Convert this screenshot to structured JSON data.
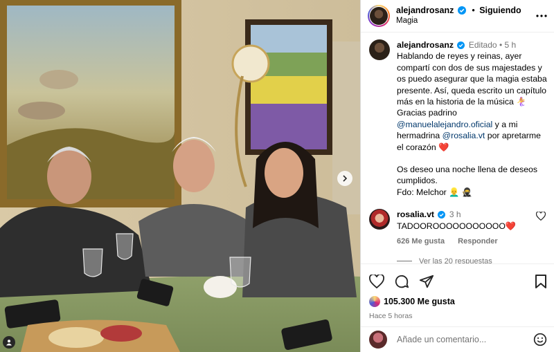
{
  "header": {
    "username": "alejandrosanz",
    "follow_status": "Siguiendo",
    "location": "Magia"
  },
  "caption": {
    "username": "alejandrosanz",
    "edited": "Editado",
    "time": "5 h",
    "text_1": "Hablando de reyes y reinas, ayer compartí con dos de sus majestades y os puedo asegurar que la magia estaba presente. Así, queda escrito un capítulo más en la historia de la música 🧜‍♀️",
    "text_2": "Gracias padrino",
    "mention_1": "@manuelalejandro.oficial",
    "text_3": " y a mi hermadrina ",
    "mention_2": "@rosalia.vt",
    "text_4": " por apretarme el corazón ❤️",
    "text_5": "Os deseo una noche llena de deseos cumplidos.",
    "text_6": "Fdo: Melchor 👱‍♂️ 🥷"
  },
  "top_comment": {
    "username": "rosalia.vt",
    "time": "3 h",
    "text": "TADOOROOOOOOOOOOO❤️",
    "likes": "626 Me gusta",
    "reply_label": "Responder",
    "view_replies": "Ver las 20 respuestas"
  },
  "post": {
    "likes": "105.300 Me gusta",
    "posted": "Hace 5 horas"
  },
  "composer": {
    "placeholder": "Añade un comentario..."
  },
  "colors": {
    "verified": "#0095f6",
    "mention": "#00376b",
    "heart": "#ed4956",
    "muted": "#737373"
  }
}
